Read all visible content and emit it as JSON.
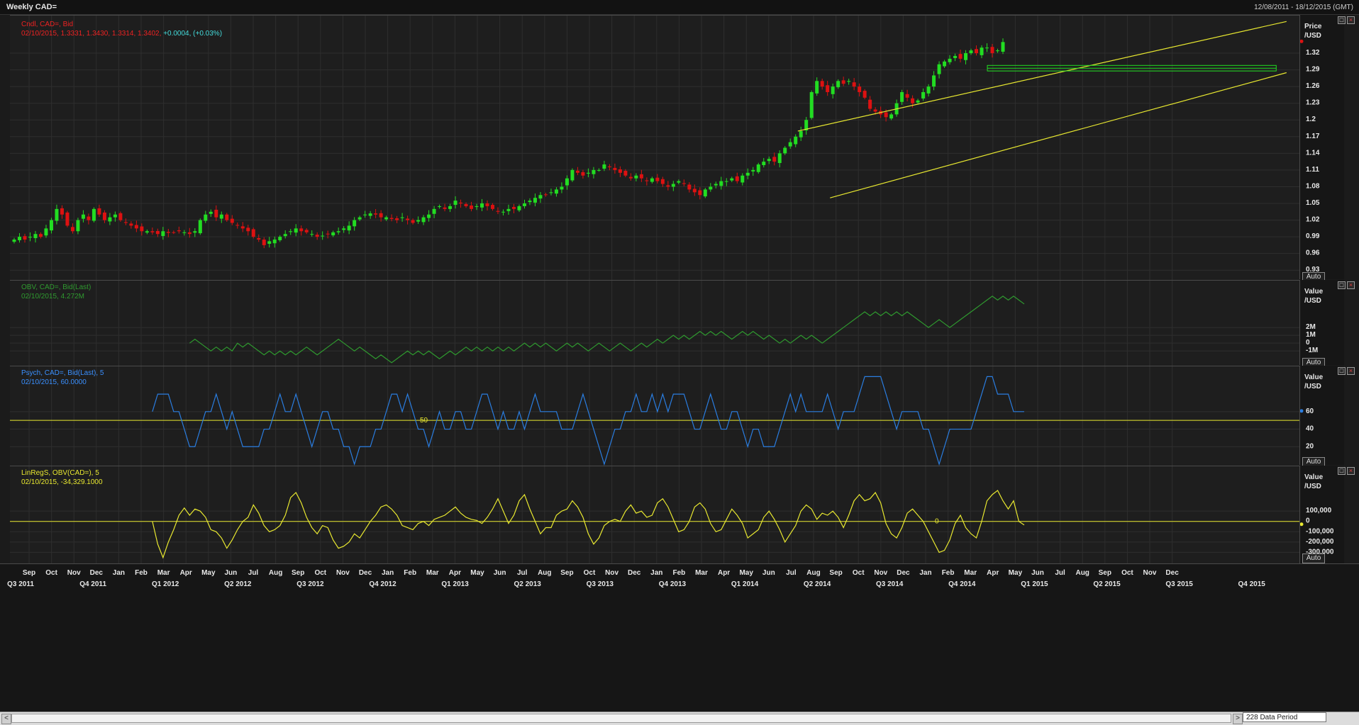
{
  "window": {
    "title": "Weekly CAD=",
    "date_range": "12/08/2011 - 18/12/2015 (GMT)"
  },
  "panels": {
    "price": {
      "legend_line1": "Cndl, CAD=, Bid",
      "legend_line2_values": "02/10/2015, 1.3331, 1.3430, 1.3314, 1.3402,",
      "legend_change": "+0.0004, (+0.03%)",
      "axis_title": "Price",
      "axis_unit": "/USD",
      "auto_label": "Auto"
    },
    "obv": {
      "legend_line1": "OBV, CAD=, Bid(Last)",
      "legend_line2": "02/10/2015, 4.272M",
      "axis_title": "Value",
      "axis_unit": "/USD",
      "auto_label": "Auto"
    },
    "psych": {
      "legend_line1": "Psych, CAD=, Bid(Last),  5",
      "legend_line2": "02/10/2015, 60.0000",
      "axis_title": "Value",
      "axis_unit": "/USD",
      "auto_label": "Auto",
      "ref_label": "50"
    },
    "linreg": {
      "legend_line1": "LinRegS, OBV(CAD=),  5",
      "legend_line2": "02/10/2015, -34,329.1000",
      "axis_title": "Value",
      "axis_unit": "/USD",
      "auto_label": "Auto",
      "ref_label": "0"
    }
  },
  "scrollbar": {
    "left_arrow": "<",
    "right_arrow": ">",
    "data_period_label": "228 Data Period"
  },
  "colors": {
    "up_candle": "#22dd22",
    "down_candle": "#dd1111",
    "channel": "#e8e830",
    "obv_line": "#2f9a2f",
    "psych_line": "#2a7de0",
    "linreg_line": "#e8e830",
    "ref_line": "#e8e830",
    "grid": "#2e2e2e",
    "legend_red": "#ee2222",
    "legend_cyan": "#44dddd"
  },
  "chart_data": [
    {
      "type": "candlestick",
      "title": "Cndl, CAD=, Bid",
      "ylim": [
        0.915,
        1.385
      ],
      "y_ticks": [
        0.93,
        0.96,
        0.99,
        1.02,
        1.05,
        1.08,
        1.11,
        1.14,
        1.17,
        1.2,
        1.23,
        1.26,
        1.29,
        1.32
      ],
      "x_ticks": [
        "Sep",
        "Oct",
        "Nov",
        "Dec",
        "Jan",
        "Feb",
        "Mar",
        "Apr",
        "May",
        "Jun",
        "Jul",
        "Aug",
        "Sep",
        "Oct",
        "Nov",
        "Dec",
        "Jan",
        "Feb",
        "Mar",
        "Apr",
        "May",
        "Jun",
        "Jul",
        "Aug",
        "Sep",
        "Oct",
        "Nov",
        "Dec",
        "Jan",
        "Feb",
        "Mar",
        "Apr",
        "May",
        "Jun",
        "Jul",
        "Aug",
        "Sep",
        "Oct",
        "Nov",
        "Dec",
        "Jan",
        "Feb",
        "Mar",
        "Apr",
        "May",
        "Jun",
        "Jul",
        "Aug",
        "Sep",
        "Oct",
        "Nov",
        "Dec"
      ],
      "quarter_ticks": [
        "Q3 2011",
        "Q4 2011",
        "Q1 2012",
        "Q2 2012",
        "Q3 2012",
        "Q4 2012",
        "Q1 2013",
        "Q2 2013",
        "Q3 2013",
        "Q4 2013",
        "Q1 2014",
        "Q2 2014",
        "Q3 2014",
        "Q4 2014",
        "Q1 2015",
        "Q2 2015",
        "Q3 2015",
        "Q4 2015"
      ],
      "last_bar": {
        "date": "02/10/2015",
        "open": 1.3331,
        "high": 1.343,
        "low": 1.3314,
        "close": 1.3402,
        "change": 0.0004,
        "change_pct": 0.03
      },
      "closes": [
        0.985,
        0.99,
        0.985,
        0.99,
        0.995,
        0.99,
        1.005,
        1.02,
        1.04,
        1.03,
        1.01,
        1.0,
        1.02,
        1.03,
        1.02,
        1.04,
        1.03,
        1.02,
        1.025,
        1.03,
        1.02,
        1.015,
        1.01,
        1.005,
        1.0,
        1.0,
        0.998,
        0.995,
        1.0,
        0.997,
        0.998,
        1.0,
        0.998,
        0.995,
        1.0,
        1.02,
        1.03,
        1.035,
        1.025,
        1.03,
        1.02,
        1.015,
        1.01,
        1.005,
        1.0,
        0.99,
        0.985,
        0.975,
        0.982,
        0.985,
        0.99,
        0.995,
        1.0,
        1.005,
        1.0,
        0.998,
        0.995,
        0.99,
        0.992,
        0.995,
        0.998,
        1.0,
        1.005,
        1.01,
        1.02,
        1.025,
        1.03,
        1.032,
        1.03,
        1.025,
        1.025,
        1.022,
        1.02,
        1.025,
        1.02,
        1.015,
        1.02,
        1.025,
        1.03,
        1.04,
        1.045,
        1.04,
        1.045,
        1.055,
        1.05,
        1.045,
        1.04,
        1.045,
        1.05,
        1.045,
        1.04,
        1.035,
        1.035,
        1.04,
        1.04,
        1.045,
        1.05,
        1.055,
        1.06,
        1.065,
        1.065,
        1.07,
        1.075,
        1.08,
        1.095,
        1.11,
        1.105,
        1.1,
        1.105,
        1.11,
        1.11,
        1.12,
        1.115,
        1.11,
        1.105,
        1.1,
        1.095,
        1.1,
        1.095,
        1.09,
        1.095,
        1.09,
        1.085,
        1.08,
        1.085,
        1.09,
        1.085,
        1.075,
        1.07,
        1.065,
        1.075,
        1.08,
        1.085,
        1.09,
        1.09,
        1.095,
        1.09,
        1.1,
        1.105,
        1.11,
        1.12,
        1.125,
        1.13,
        1.125,
        1.14,
        1.15,
        1.16,
        1.17,
        1.18,
        1.2,
        1.25,
        1.27,
        1.26,
        1.25,
        1.26,
        1.27,
        1.265,
        1.27,
        1.26,
        1.25,
        1.24,
        1.22,
        1.215,
        1.21,
        1.205,
        1.21,
        1.23,
        1.25,
        1.24,
        1.23,
        1.235,
        1.25,
        1.26,
        1.28,
        1.3,
        1.305,
        1.31,
        1.315,
        1.31,
        1.32,
        1.325,
        1.32,
        1.33,
        1.33,
        1.32,
        1.325,
        1.34
      ],
      "channel": {
        "upper": [
          [
            0.611,
            1.18
          ],
          [
            0.99,
            1.377
          ]
        ],
        "lower": [
          [
            0.636,
            1.06
          ],
          [
            0.99,
            1.285
          ]
        ]
      },
      "box": [
        [
          0.758,
          1.298
        ],
        [
          0.982,
          1.288
        ]
      ]
    },
    {
      "type": "line",
      "title": "OBV, CAD=, Bid(Last)",
      "ylim": [
        -2700000,
        7800000
      ],
      "y_ticks": [
        2000000,
        1000000,
        0,
        -1000000
      ],
      "y_tick_labels": [
        "2M",
        "1M",
        "0",
        "-1M"
      ],
      "values": [
        0,
        0.5,
        0,
        -0.5,
        -1,
        -0.5,
        -1,
        -0.5,
        -1,
        0,
        -0.5,
        0,
        -0.5,
        -1,
        -1.5,
        -1,
        -1.5,
        -1,
        -1.5,
        -1,
        -1.5,
        -1,
        -0.5,
        -1,
        -1.5,
        -1,
        -0.5,
        0,
        0.5,
        0,
        -0.5,
        -1,
        -0.5,
        -1,
        -1.5,
        -2,
        -1.5,
        -2,
        -2.5,
        -2,
        -1.5,
        -1,
        -1.5,
        -1,
        -1.5,
        -1,
        -1.5,
        -2,
        -1.5,
        -1,
        -1.5,
        -1,
        -0.5,
        -1,
        -0.5,
        -1,
        -0.5,
        -1,
        -0.5,
        -1,
        -0.5,
        -1,
        -0.5,
        0,
        -0.5,
        0,
        -0.5,
        0,
        -0.5,
        -1,
        -0.5,
        0,
        -0.5,
        0,
        -0.5,
        -1,
        -0.5,
        0,
        -0.5,
        -1,
        -0.5,
        0,
        -0.5,
        -1,
        -0.5,
        0,
        -0.5,
        0,
        0.5,
        0,
        0.5,
        1,
        0.5,
        1,
        0.5,
        1,
        1.5,
        1,
        1.5,
        1,
        1.5,
        1,
        0.5,
        1,
        1.5,
        1,
        1.5,
        1,
        0.5,
        1,
        0.5,
        0,
        0.5,
        0,
        0.5,
        1,
        0.5,
        1,
        0.5,
        0,
        0.5,
        1,
        1.5,
        2,
        2.5,
        3,
        3.5,
        4,
        3.5,
        4,
        3.5,
        4,
        3.5,
        4,
        3.5,
        4,
        3.5,
        3,
        2.5,
        2,
        2.5,
        3,
        2.5,
        2,
        2.5,
        3,
        3.5,
        4,
        4.5,
        5,
        5.5,
        6,
        5.5,
        6,
        5.5,
        6,
        5.5,
        5
      ],
      "values_unit": "M",
      "last": {
        "date": "02/10/2015",
        "value": 4272000
      }
    },
    {
      "type": "line",
      "title": "Psych, CAD=, Bid(Last),  5",
      "ylim": [
        0,
        110
      ],
      "y_ticks": [
        60,
        40,
        20
      ],
      "ref_line": 50,
      "values": [
        60,
        80,
        80,
        80,
        60,
        60,
        40,
        20,
        20,
        40,
        60,
        60,
        80,
        60,
        40,
        60,
        40,
        20,
        20,
        20,
        20,
        40,
        40,
        60,
        80,
        60,
        60,
        80,
        60,
        40,
        20,
        40,
        60,
        60,
        40,
        40,
        20,
        20,
        0,
        20,
        20,
        20,
        40,
        40,
        60,
        80,
        80,
        60,
        80,
        60,
        40,
        40,
        20,
        40,
        60,
        40,
        40,
        60,
        60,
        40,
        40,
        60,
        80,
        80,
        60,
        40,
        60,
        40,
        40,
        60,
        40,
        60,
        80,
        60,
        60,
        60,
        60,
        40,
        40,
        40,
        60,
        80,
        60,
        40,
        20,
        0,
        20,
        40,
        40,
        60,
        60,
        80,
        60,
        60,
        80,
        60,
        80,
        60,
        80,
        80,
        80,
        60,
        40,
        40,
        60,
        80,
        60,
        40,
        40,
        60,
        60,
        40,
        20,
        40,
        40,
        20,
        20,
        20,
        40,
        60,
        80,
        60,
        80,
        60,
        60,
        60,
        60,
        80,
        60,
        40,
        60,
        60,
        60,
        80,
        100,
        100,
        100,
        100,
        80,
        60,
        40,
        60,
        60,
        60,
        60,
        40,
        40,
        20,
        0,
        20,
        40,
        40,
        40,
        40,
        40,
        60,
        80,
        100,
        100,
        80,
        80,
        80,
        60,
        60,
        60
      ],
      "last": {
        "date": "02/10/2015",
        "value": 60
      }
    },
    {
      "type": "line",
      "title": "LinRegS, OBV(CAD=),  5",
      "ylim": [
        -400000,
        520000
      ],
      "y_ticks": [
        100000,
        0,
        -100000,
        -200000,
        -300000
      ],
      "y_tick_labels": [
        "100,000",
        "0",
        "-100,000",
        "-200,000",
        "-300,000"
      ],
      "ref_line": 0,
      "values": [
        0,
        -220000,
        -350000,
        -200000,
        -80000,
        60000,
        130000,
        60000,
        120000,
        100000,
        40000,
        -80000,
        -100000,
        -160000,
        -260000,
        -180000,
        -80000,
        0,
        40000,
        160000,
        80000,
        -40000,
        -100000,
        -80000,
        -40000,
        60000,
        230000,
        280000,
        180000,
        40000,
        -60000,
        -120000,
        -40000,
        -60000,
        -180000,
        -260000,
        -240000,
        -200000,
        -120000,
        -160000,
        -80000,
        0,
        60000,
        140000,
        160000,
        120000,
        60000,
        -40000,
        -60000,
        -80000,
        -20000,
        0,
        -40000,
        20000,
        40000,
        60000,
        100000,
        140000,
        80000,
        40000,
        20000,
        10000,
        -20000,
        40000,
        120000,
        220000,
        100000,
        -20000,
        60000,
        200000,
        260000,
        120000,
        0,
        -120000,
        -60000,
        -60000,
        60000,
        100000,
        120000,
        200000,
        140000,
        40000,
        -120000,
        -220000,
        -160000,
        -40000,
        0,
        20000,
        0,
        100000,
        160000,
        80000,
        100000,
        40000,
        60000,
        180000,
        220000,
        140000,
        20000,
        -100000,
        -80000,
        0,
        140000,
        180000,
        120000,
        -20000,
        -100000,
        -80000,
        20000,
        120000,
        60000,
        -20000,
        -160000,
        -120000,
        -80000,
        40000,
        100000,
        20000,
        -80000,
        -200000,
        -120000,
        -40000,
        100000,
        160000,
        120000,
        20000,
        80000,
        60000,
        100000,
        40000,
        -60000,
        60000,
        200000,
        260000,
        200000,
        220000,
        280000,
        180000,
        -20000,
        -120000,
        -160000,
        -60000,
        80000,
        120000,
        60000,
        0,
        -100000,
        -200000,
        -300000,
        -280000,
        -180000,
        -20000,
        60000,
        -60000,
        -120000,
        -160000,
        0,
        200000,
        260000,
        300000,
        200000,
        120000,
        200000,
        0,
        -34329
      ],
      "last": {
        "date": "02/10/2015",
        "value": -34329.1
      }
    }
  ]
}
